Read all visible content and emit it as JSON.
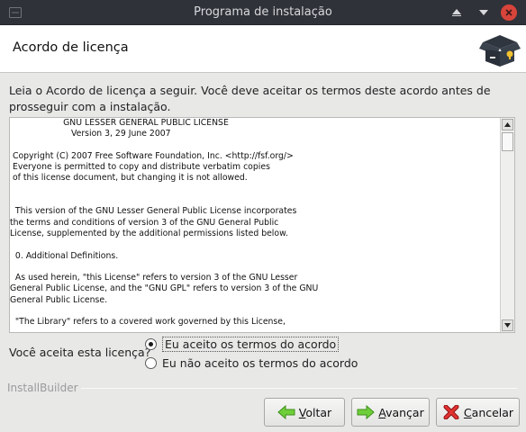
{
  "window": {
    "title": "Programa de instalação"
  },
  "header": {
    "title": "Acordo de licença"
  },
  "intro": "Leia o Acordo de licença a seguir. Você deve aceitar os termos deste acordo antes de prosseguir com a instalação.",
  "license_text": "                    GNU LESSER GENERAL PUBLIC LICENSE\n                       Version 3, 29 June 2007\n\n Copyright (C) 2007 Free Software Foundation, Inc. <http://fsf.org/>\n Everyone is permitted to copy and distribute verbatim copies\n of this license document, but changing it is not allowed.\n\n\n  This version of the GNU Lesser General Public License incorporates\nthe terms and conditions of version 3 of the GNU General Public\nLicense, supplemented by the additional permissions listed below.\n\n  0. Additional Definitions.\n\n  As used herein, \"this License\" refers to version 3 of the GNU Lesser\nGeneral Public License, and the \"GNU GPL\" refers to version 3 of the GNU\nGeneral Public License.\n\n  \"The Library\" refers to a covered work governed by this License,",
  "question": "Você aceita esta licença?",
  "options": {
    "accept": "Eu aceito os termos do acordo",
    "decline": "Eu não aceito os termos do acordo",
    "selected": "accept"
  },
  "footer_brand": "InstallBuilder",
  "buttons": {
    "back": "Voltar",
    "next": "Avançar",
    "cancel": "Cancelar"
  }
}
